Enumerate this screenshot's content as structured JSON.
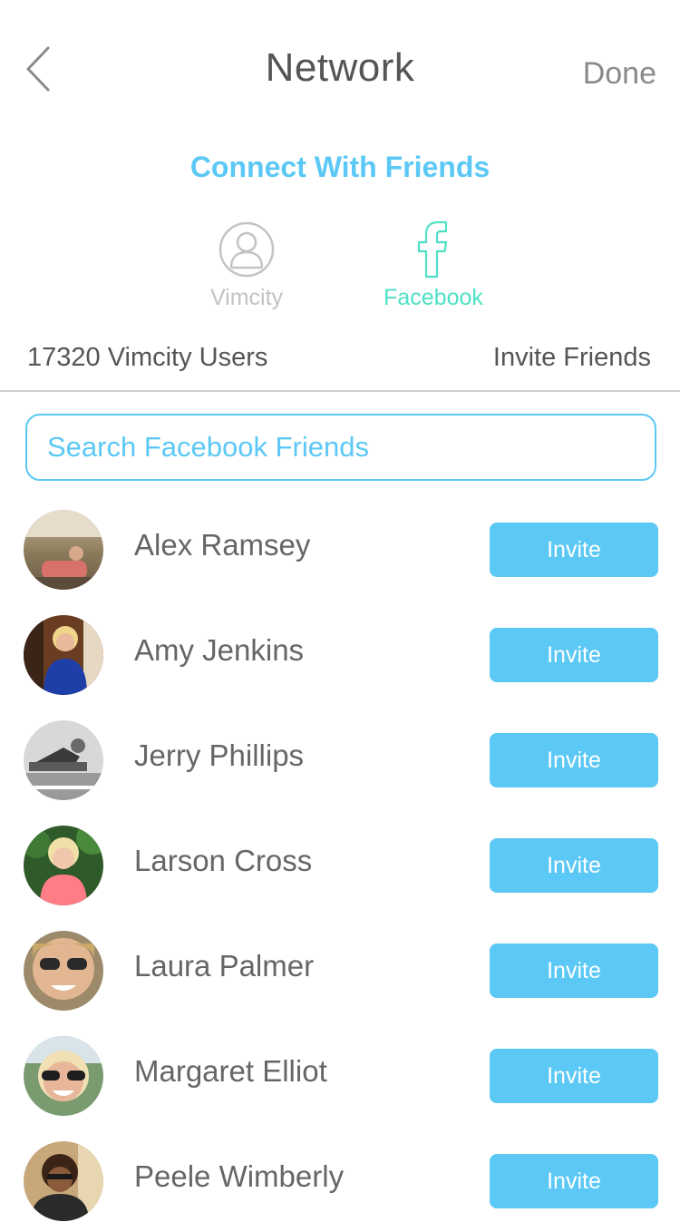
{
  "header": {
    "title": "Network",
    "done_label": "Done"
  },
  "connect": {
    "heading": "Connect With Friends",
    "tabs": [
      {
        "label": "Vimcity",
        "icon": "user-circle-icon",
        "active": false
      },
      {
        "label": "Facebook",
        "icon": "facebook-icon",
        "active": true
      }
    ]
  },
  "summary": {
    "users_count": "17320 Vimcity Users",
    "invite_friends_label": "Invite Friends"
  },
  "search": {
    "placeholder": "Search Facebook Friends",
    "value": ""
  },
  "friends": [
    {
      "name": "Alex Ramsey",
      "invite_label": "Invite"
    },
    {
      "name": "Amy Jenkins",
      "invite_label": "Invite"
    },
    {
      "name": "Jerry Phillips",
      "invite_label": "Invite"
    },
    {
      "name": "Larson Cross",
      "invite_label": "Invite"
    },
    {
      "name": "Laura Palmer",
      "invite_label": "Invite"
    },
    {
      "name": "Margaret Elliot",
      "invite_label": "Invite"
    },
    {
      "name": "Peele Wimberly",
      "invite_label": "Invite"
    }
  ],
  "colors": {
    "accent": "#5bc8f5",
    "facebook_tab": "#4fe0c7",
    "inactive_tab": "#c3c3c3",
    "text": "#555555"
  }
}
